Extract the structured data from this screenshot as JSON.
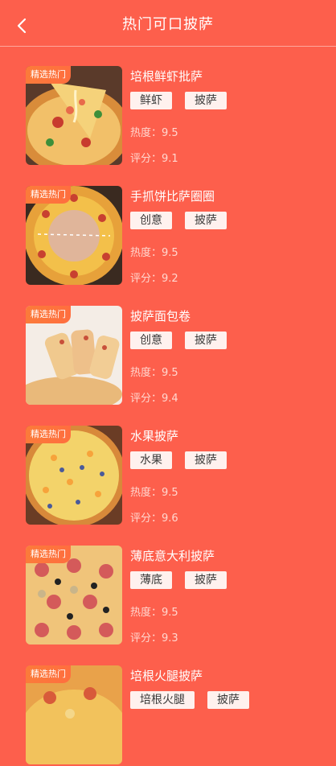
{
  "header": {
    "title": "热门可口披萨",
    "back_icon": "chevron-left-icon"
  },
  "badge_label": "精选热门",
  "items": [
    {
      "name": "培根鲜虾批萨",
      "tags": [
        "鲜虾",
        "披萨"
      ],
      "heat": "热度：9.5",
      "rating": "评分：9.1",
      "image_desc": "pizza-slice-photo"
    },
    {
      "name": "手抓饼比萨圈圈",
      "tags": [
        "创意",
        "披萨"
      ],
      "heat": "热度：9.5",
      "rating": "评分：9.2",
      "image_desc": "pizza-ring-photo"
    },
    {
      "name": "披萨面包卷",
      "tags": [
        "创意",
        "披萨"
      ],
      "heat": "热度：9.5",
      "rating": "评分：9.4",
      "image_desc": "pizza-bread-roll-photo"
    },
    {
      "name": "水果披萨",
      "tags": [
        "水果",
        "披萨"
      ],
      "heat": "热度：9.5",
      "rating": "评分：9.6",
      "image_desc": "fruit-pizza-photo"
    },
    {
      "name": "薄底意大利披萨",
      "tags": [
        "薄底",
        "披萨"
      ],
      "heat": "热度：9.5",
      "rating": "评分：9.3",
      "image_desc": "italian-pizza-photo"
    },
    {
      "name": "培根火腿披萨",
      "tags": [
        "培根火腿",
        "披萨"
      ],
      "heat": "",
      "rating": "",
      "image_desc": "bacon-ham-pizza-photo"
    }
  ],
  "colors": {
    "background": "#fd5f4c",
    "tag_bg": "#fff1ee",
    "badge": "#fb7b3a"
  }
}
